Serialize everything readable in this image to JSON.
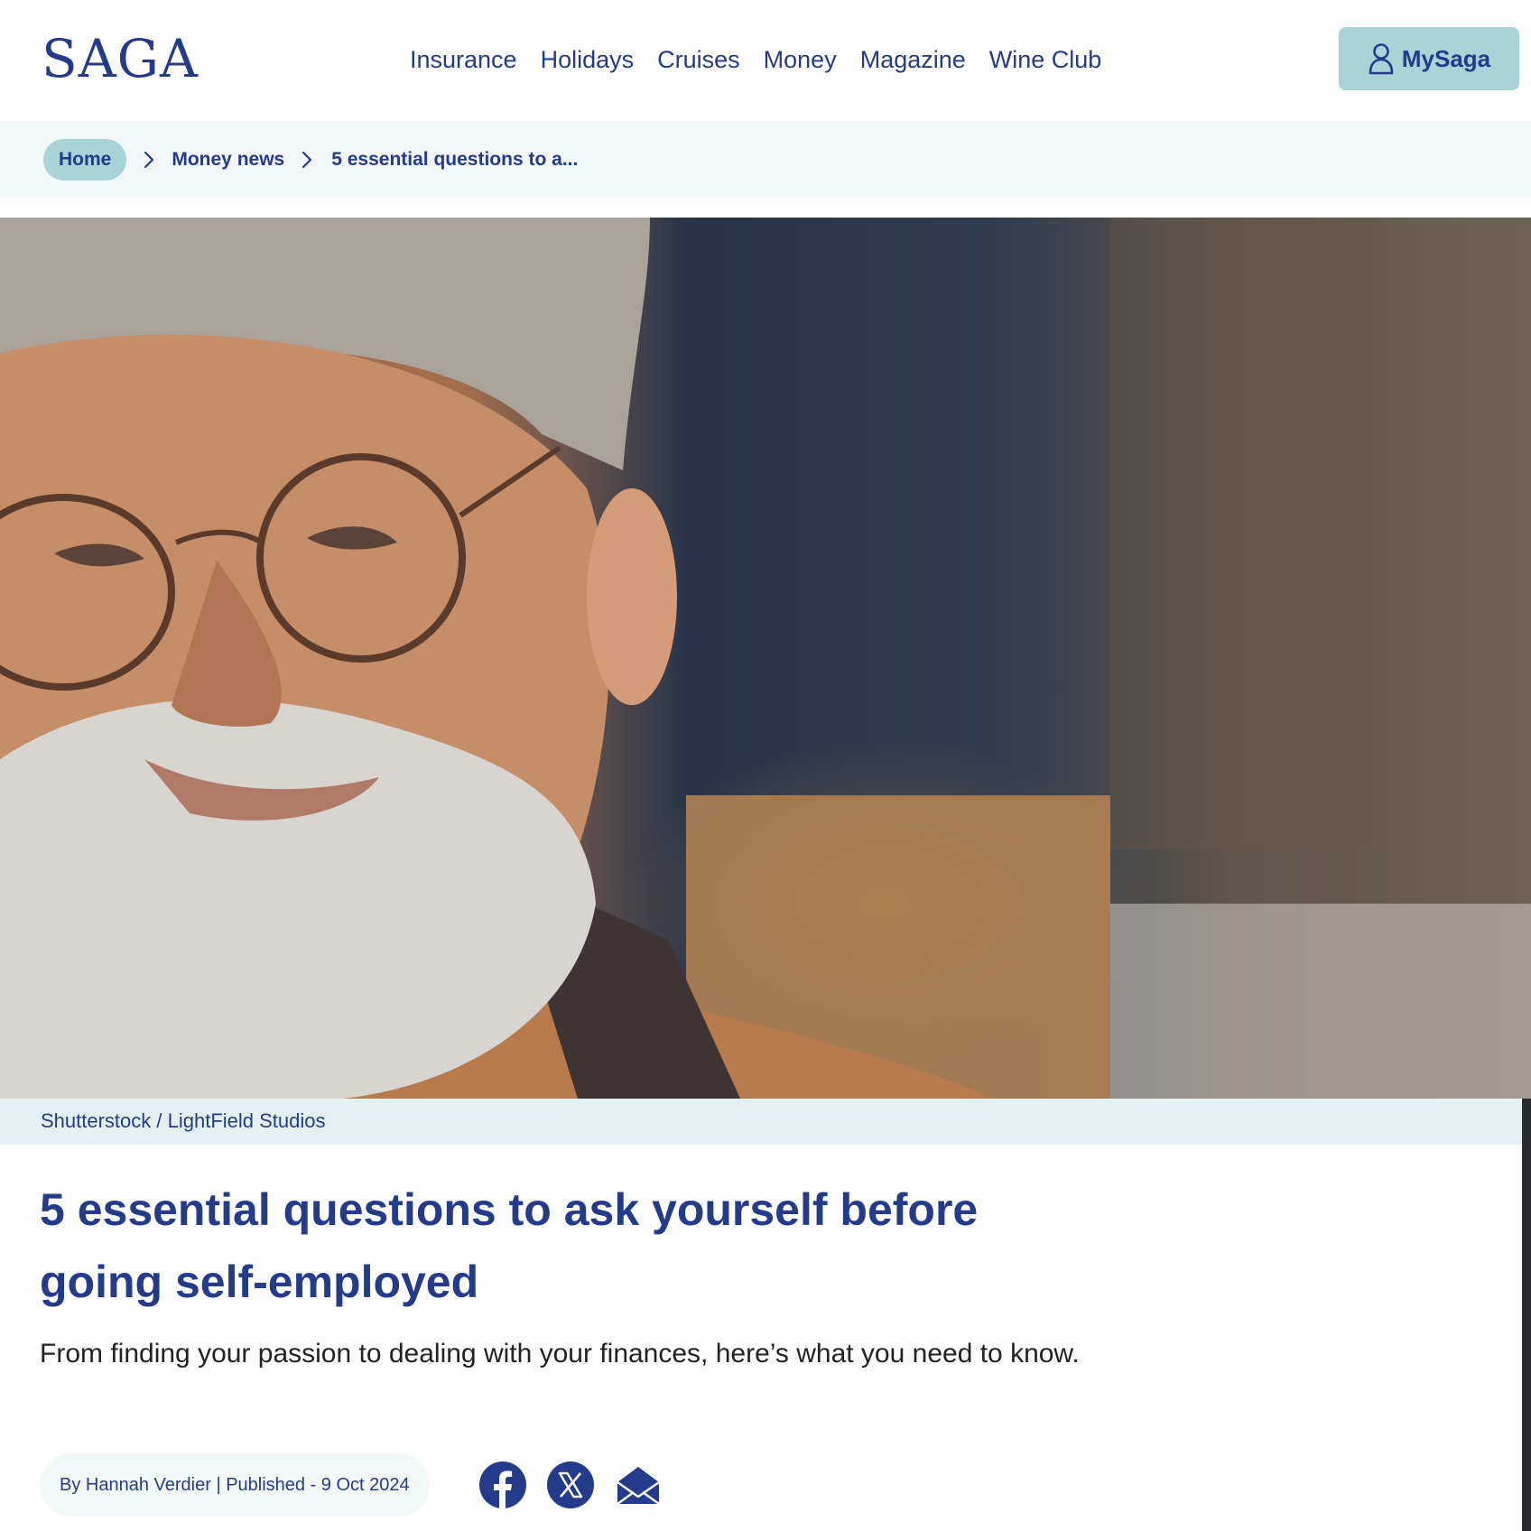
{
  "header": {
    "logo": "SAGA",
    "nav": [
      "Insurance",
      "Holidays",
      "Cruises",
      "Money",
      "Magazine",
      "Wine Club"
    ],
    "account_label": "MySaga",
    "account_icon": "user-icon"
  },
  "breadcrumb": {
    "home": "Home",
    "section": "Money news",
    "current": "5 essential questions to a...",
    "separator_icon": "chevron-right-icon"
  },
  "hero": {
    "image_description": "Photo of a smiling older man with grey beard and round glasses",
    "credit": "Shutterstock / LightField Studios"
  },
  "article": {
    "title": "5 essential questions to ask yourself before going self-employed",
    "subtitle": "From finding your passion to dealing with your finances, here’s what you need to know.",
    "byline": "By Hannah Verdier | Published - 9 Oct 2024"
  },
  "share": {
    "icons": [
      "facebook-icon",
      "x-icon",
      "email-icon"
    ]
  },
  "colors": {
    "brand_navy": "#233b8a",
    "accent_teal": "#a9d3d6",
    "breadcrumb_bg": "#f2f7f7",
    "caption_bg": "#e4f1f2"
  }
}
